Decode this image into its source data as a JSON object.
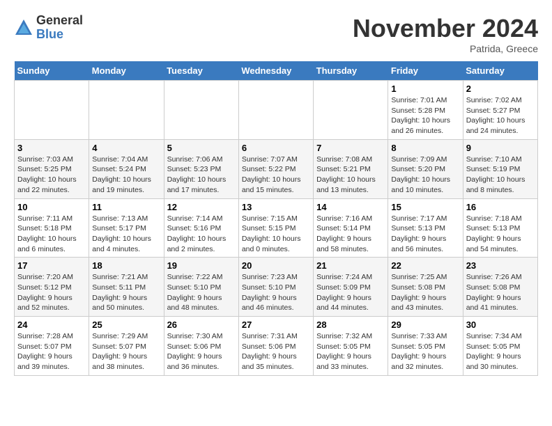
{
  "logo": {
    "general": "General",
    "blue": "Blue"
  },
  "title": "November 2024",
  "location": "Patrida, Greece",
  "days_header": [
    "Sunday",
    "Monday",
    "Tuesday",
    "Wednesday",
    "Thursday",
    "Friday",
    "Saturday"
  ],
  "weeks": [
    [
      {
        "day": "",
        "info": ""
      },
      {
        "day": "",
        "info": ""
      },
      {
        "day": "",
        "info": ""
      },
      {
        "day": "",
        "info": ""
      },
      {
        "day": "",
        "info": ""
      },
      {
        "day": "1",
        "info": "Sunrise: 7:01 AM\nSunset: 5:28 PM\nDaylight: 10 hours and 26 minutes."
      },
      {
        "day": "2",
        "info": "Sunrise: 7:02 AM\nSunset: 5:27 PM\nDaylight: 10 hours and 24 minutes."
      }
    ],
    [
      {
        "day": "3",
        "info": "Sunrise: 7:03 AM\nSunset: 5:25 PM\nDaylight: 10 hours and 22 minutes."
      },
      {
        "day": "4",
        "info": "Sunrise: 7:04 AM\nSunset: 5:24 PM\nDaylight: 10 hours and 19 minutes."
      },
      {
        "day": "5",
        "info": "Sunrise: 7:06 AM\nSunset: 5:23 PM\nDaylight: 10 hours and 17 minutes."
      },
      {
        "day": "6",
        "info": "Sunrise: 7:07 AM\nSunset: 5:22 PM\nDaylight: 10 hours and 15 minutes."
      },
      {
        "day": "7",
        "info": "Sunrise: 7:08 AM\nSunset: 5:21 PM\nDaylight: 10 hours and 13 minutes."
      },
      {
        "day": "8",
        "info": "Sunrise: 7:09 AM\nSunset: 5:20 PM\nDaylight: 10 hours and 10 minutes."
      },
      {
        "day": "9",
        "info": "Sunrise: 7:10 AM\nSunset: 5:19 PM\nDaylight: 10 hours and 8 minutes."
      }
    ],
    [
      {
        "day": "10",
        "info": "Sunrise: 7:11 AM\nSunset: 5:18 PM\nDaylight: 10 hours and 6 minutes."
      },
      {
        "day": "11",
        "info": "Sunrise: 7:13 AM\nSunset: 5:17 PM\nDaylight: 10 hours and 4 minutes."
      },
      {
        "day": "12",
        "info": "Sunrise: 7:14 AM\nSunset: 5:16 PM\nDaylight: 10 hours and 2 minutes."
      },
      {
        "day": "13",
        "info": "Sunrise: 7:15 AM\nSunset: 5:15 PM\nDaylight: 10 hours and 0 minutes."
      },
      {
        "day": "14",
        "info": "Sunrise: 7:16 AM\nSunset: 5:14 PM\nDaylight: 9 hours and 58 minutes."
      },
      {
        "day": "15",
        "info": "Sunrise: 7:17 AM\nSunset: 5:13 PM\nDaylight: 9 hours and 56 minutes."
      },
      {
        "day": "16",
        "info": "Sunrise: 7:18 AM\nSunset: 5:13 PM\nDaylight: 9 hours and 54 minutes."
      }
    ],
    [
      {
        "day": "17",
        "info": "Sunrise: 7:20 AM\nSunset: 5:12 PM\nDaylight: 9 hours and 52 minutes."
      },
      {
        "day": "18",
        "info": "Sunrise: 7:21 AM\nSunset: 5:11 PM\nDaylight: 9 hours and 50 minutes."
      },
      {
        "day": "19",
        "info": "Sunrise: 7:22 AM\nSunset: 5:10 PM\nDaylight: 9 hours and 48 minutes."
      },
      {
        "day": "20",
        "info": "Sunrise: 7:23 AM\nSunset: 5:10 PM\nDaylight: 9 hours and 46 minutes."
      },
      {
        "day": "21",
        "info": "Sunrise: 7:24 AM\nSunset: 5:09 PM\nDaylight: 9 hours and 44 minutes."
      },
      {
        "day": "22",
        "info": "Sunrise: 7:25 AM\nSunset: 5:08 PM\nDaylight: 9 hours and 43 minutes."
      },
      {
        "day": "23",
        "info": "Sunrise: 7:26 AM\nSunset: 5:08 PM\nDaylight: 9 hours and 41 minutes."
      }
    ],
    [
      {
        "day": "24",
        "info": "Sunrise: 7:28 AM\nSunset: 5:07 PM\nDaylight: 9 hours and 39 minutes."
      },
      {
        "day": "25",
        "info": "Sunrise: 7:29 AM\nSunset: 5:07 PM\nDaylight: 9 hours and 38 minutes."
      },
      {
        "day": "26",
        "info": "Sunrise: 7:30 AM\nSunset: 5:06 PM\nDaylight: 9 hours and 36 minutes."
      },
      {
        "day": "27",
        "info": "Sunrise: 7:31 AM\nSunset: 5:06 PM\nDaylight: 9 hours and 35 minutes."
      },
      {
        "day": "28",
        "info": "Sunrise: 7:32 AM\nSunset: 5:05 PM\nDaylight: 9 hours and 33 minutes."
      },
      {
        "day": "29",
        "info": "Sunrise: 7:33 AM\nSunset: 5:05 PM\nDaylight: 9 hours and 32 minutes."
      },
      {
        "day": "30",
        "info": "Sunrise: 7:34 AM\nSunset: 5:05 PM\nDaylight: 9 hours and 30 minutes."
      }
    ]
  ]
}
